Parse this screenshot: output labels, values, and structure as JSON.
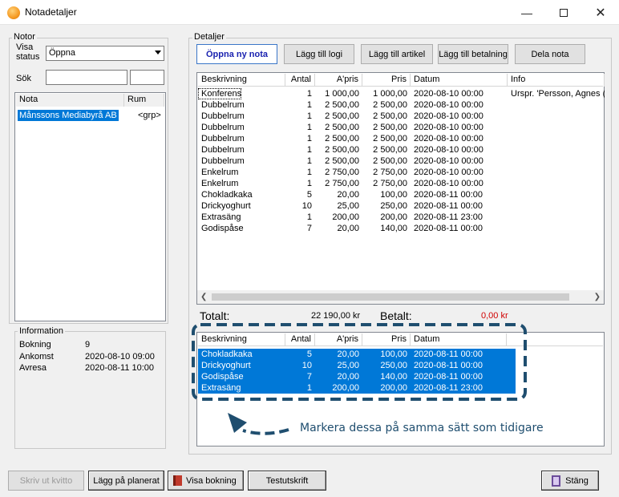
{
  "window": {
    "title": "Notadetaljer"
  },
  "notor": {
    "group_label": "Notor",
    "visa_status_label_1": "Visa",
    "visa_status_label_2": "status",
    "status_value": "Öppna",
    "sok_label": "Sök",
    "list_headers": [
      "Nota",
      "Rum"
    ],
    "list_items": [
      {
        "nota": "Månssons Mediabyrå AB",
        "rum": "<grp>"
      }
    ]
  },
  "information": {
    "group_label": "Information",
    "rows": [
      {
        "label": "Bokning",
        "value": "9"
      },
      {
        "label": "Ankomst",
        "value": "2020-08-10 09:00"
      },
      {
        "label": "Avresa",
        "value": "2020-08-11 10:00"
      }
    ]
  },
  "detaljer": {
    "group_label": "Detaljer",
    "buttons": {
      "open_new": "Öppna ny nota",
      "add_logi": "Lägg till logi",
      "add_artikel": "Lägg till artikel",
      "add_betalning": "Lägg till betalning",
      "dela": "Dela nota"
    },
    "columns": [
      "Beskrivning",
      "Antal",
      "A'pris",
      "Pris",
      "Datum",
      "Info"
    ],
    "rows": [
      {
        "beskrivning": "Konferens",
        "antal": "1",
        "apris": "1 000,00",
        "pris": "1 000,00",
        "datum": "2020-08-10 00:00",
        "info": "Urspr. 'Persson, Agnes ("
      },
      {
        "beskrivning": "Dubbelrum",
        "antal": "1",
        "apris": "2 500,00",
        "pris": "2 500,00",
        "datum": "2020-08-10 00:00",
        "info": ""
      },
      {
        "beskrivning": "Dubbelrum",
        "antal": "1",
        "apris": "2 500,00",
        "pris": "2 500,00",
        "datum": "2020-08-10 00:00",
        "info": ""
      },
      {
        "beskrivning": "Dubbelrum",
        "antal": "1",
        "apris": "2 500,00",
        "pris": "2 500,00",
        "datum": "2020-08-10 00:00",
        "info": ""
      },
      {
        "beskrivning": "Dubbelrum",
        "antal": "1",
        "apris": "2 500,00",
        "pris": "2 500,00",
        "datum": "2020-08-10 00:00",
        "info": ""
      },
      {
        "beskrivning": "Dubbelrum",
        "antal": "1",
        "apris": "2 500,00",
        "pris": "2 500,00",
        "datum": "2020-08-10 00:00",
        "info": ""
      },
      {
        "beskrivning": "Dubbelrum",
        "antal": "1",
        "apris": "2 500,00",
        "pris": "2 500,00",
        "datum": "2020-08-10 00:00",
        "info": ""
      },
      {
        "beskrivning": "Enkelrum",
        "antal": "1",
        "apris": "2 750,00",
        "pris": "2 750,00",
        "datum": "2020-08-10 00:00",
        "info": ""
      },
      {
        "beskrivning": "Enkelrum",
        "antal": "1",
        "apris": "2 750,00",
        "pris": "2 750,00",
        "datum": "2020-08-10 00:00",
        "info": ""
      },
      {
        "beskrivning": "Chokladkaka",
        "antal": "5",
        "apris": "20,00",
        "pris": "100,00",
        "datum": "2020-08-11 00:00",
        "info": ""
      },
      {
        "beskrivning": "Drickyoghurt",
        "antal": "10",
        "apris": "25,00",
        "pris": "250,00",
        "datum": "2020-08-11 00:00",
        "info": ""
      },
      {
        "beskrivning": "Extrasäng",
        "antal": "1",
        "apris": "200,00",
        "pris": "200,00",
        "datum": "2020-08-11 23:00",
        "info": ""
      },
      {
        "beskrivning": "Godispåse",
        "antal": "7",
        "apris": "20,00",
        "pris": "140,00",
        "datum": "2020-08-11 00:00",
        "info": ""
      }
    ],
    "totalt_label": "Totalt:",
    "totalt_value": "22 190,00 kr",
    "betalt_label": "Betalt:",
    "betalt_value": "0,00 kr",
    "betalt_color": "#d00000"
  },
  "lower": {
    "columns": [
      "Beskrivning",
      "Antal",
      "A'pris",
      "Pris",
      "Datum"
    ],
    "rows": [
      {
        "beskrivning": "Chokladkaka",
        "antal": "5",
        "apris": "20,00",
        "pris": "100,00",
        "datum": "2020-08-11 00:00"
      },
      {
        "beskrivning": "Drickyoghurt",
        "antal": "10",
        "apris": "25,00",
        "pris": "250,00",
        "datum": "2020-08-11 00:00"
      },
      {
        "beskrivning": "Godispåse",
        "antal": "7",
        "apris": "20,00",
        "pris": "140,00",
        "datum": "2020-08-11 00:00"
      },
      {
        "beskrivning": "Extrasäng",
        "antal": "1",
        "apris": "200,00",
        "pris": "200,00",
        "datum": "2020-08-11 23:00"
      }
    ],
    "selection_color": "#0078d7"
  },
  "annotation": {
    "text": "Markera dessa på samma sätt som tidigare",
    "color": "#1f4e6f"
  },
  "footer": {
    "print_receipt": "Skriv ut kvitto",
    "add_planned": "Lägg på planerat",
    "show_booking": "Visa bokning",
    "test_print": "Testutskrift",
    "close": "Stäng"
  }
}
